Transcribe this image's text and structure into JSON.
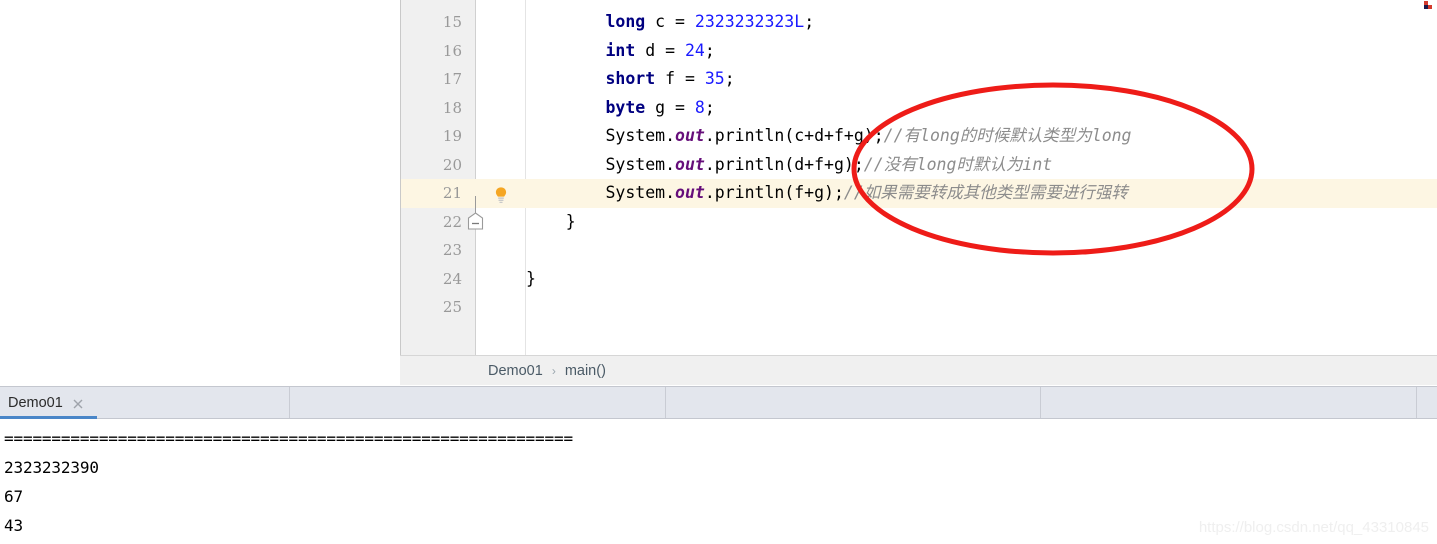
{
  "editor": {
    "clipped_top_line": ");",
    "lines": [
      {
        "number": "15",
        "indent": "        ",
        "tokens": [
          {
            "text": "long",
            "style": "kw"
          },
          {
            "text": " c = ",
            "style": "plain"
          },
          {
            "text": "2323232323L",
            "style": "num"
          },
          {
            "text": ";",
            "style": "plain"
          }
        ],
        "current": false
      },
      {
        "number": "16",
        "indent": "        ",
        "tokens": [
          {
            "text": "int",
            "style": "kw"
          },
          {
            "text": " d = ",
            "style": "plain"
          },
          {
            "text": "24",
            "style": "num"
          },
          {
            "text": ";",
            "style": "plain"
          }
        ],
        "current": false
      },
      {
        "number": "17",
        "indent": "        ",
        "tokens": [
          {
            "text": "short",
            "style": "kw"
          },
          {
            "text": " f = ",
            "style": "plain"
          },
          {
            "text": "35",
            "style": "num"
          },
          {
            "text": ";",
            "style": "plain"
          }
        ],
        "current": false
      },
      {
        "number": "18",
        "indent": "        ",
        "tokens": [
          {
            "text": "byte",
            "style": "kw"
          },
          {
            "text": " g = ",
            "style": "plain"
          },
          {
            "text": "8",
            "style": "num"
          },
          {
            "text": ";",
            "style": "plain"
          }
        ],
        "current": false
      },
      {
        "number": "19",
        "indent": "        ",
        "tokens": [
          {
            "text": "System.",
            "style": "plain"
          },
          {
            "text": "out",
            "style": "fld"
          },
          {
            "text": ".println(c+d+f+g);",
            "style": "plain"
          },
          {
            "text": "//有long的时候默认类型为long",
            "style": "cmt"
          }
        ],
        "current": false
      },
      {
        "number": "20",
        "indent": "        ",
        "tokens": [
          {
            "text": "System.",
            "style": "plain"
          },
          {
            "text": "out",
            "style": "fld"
          },
          {
            "text": ".println(d+f+g);",
            "style": "plain"
          },
          {
            "text": "//没有long时默认为int",
            "style": "cmt"
          }
        ],
        "current": false
      },
      {
        "number": "21",
        "indent": "        ",
        "tokens": [
          {
            "text": "System.",
            "style": "plain"
          },
          {
            "text": "out",
            "style": "fld"
          },
          {
            "text": ".println(f+g);",
            "style": "plain"
          },
          {
            "text": "//如果需要转成其他类型需要进行强转",
            "style": "cmt"
          }
        ],
        "current": true
      },
      {
        "number": "22",
        "indent": "    ",
        "tokens": [
          {
            "text": "}",
            "style": "plain"
          }
        ],
        "current": false
      },
      {
        "number": "23",
        "indent": "",
        "tokens": [],
        "current": false
      },
      {
        "number": "24",
        "indent": "",
        "tokens": [
          {
            "text": "}",
            "style": "plain"
          }
        ],
        "current": false
      },
      {
        "number": "25",
        "indent": "",
        "tokens": [],
        "current": false
      }
    ],
    "intention_hint": "lightbulb",
    "fold_state": "collapsible"
  },
  "breadcrumb": {
    "class_name": "Demo01",
    "separator": "›",
    "method_name": "main()"
  },
  "tool_window": {
    "tab_label": "Demo01",
    "close_icon": "close-icon",
    "output_lines": [
      "============================================================",
      "2323232390",
      "67",
      "43"
    ]
  },
  "watermark": {
    "text": "https://blog.csdn.net/qq_43310845"
  },
  "annotation": {
    "shape": "ellipse",
    "color": "#ee1c18",
    "stroke_width": 5
  },
  "colors": {
    "keyword": "#000080",
    "number": "#1a1aff",
    "field": "#660e7a",
    "comment": "#8c8c8c",
    "current_line_bg": "#fdf6e3",
    "gutter_bg": "#f0f0f0",
    "tab_bar_bg": "#e3e6ed",
    "tab_underline": "#4a86c8",
    "annotation_red": "#ee1c18",
    "lightbulb": "#f5a623"
  }
}
